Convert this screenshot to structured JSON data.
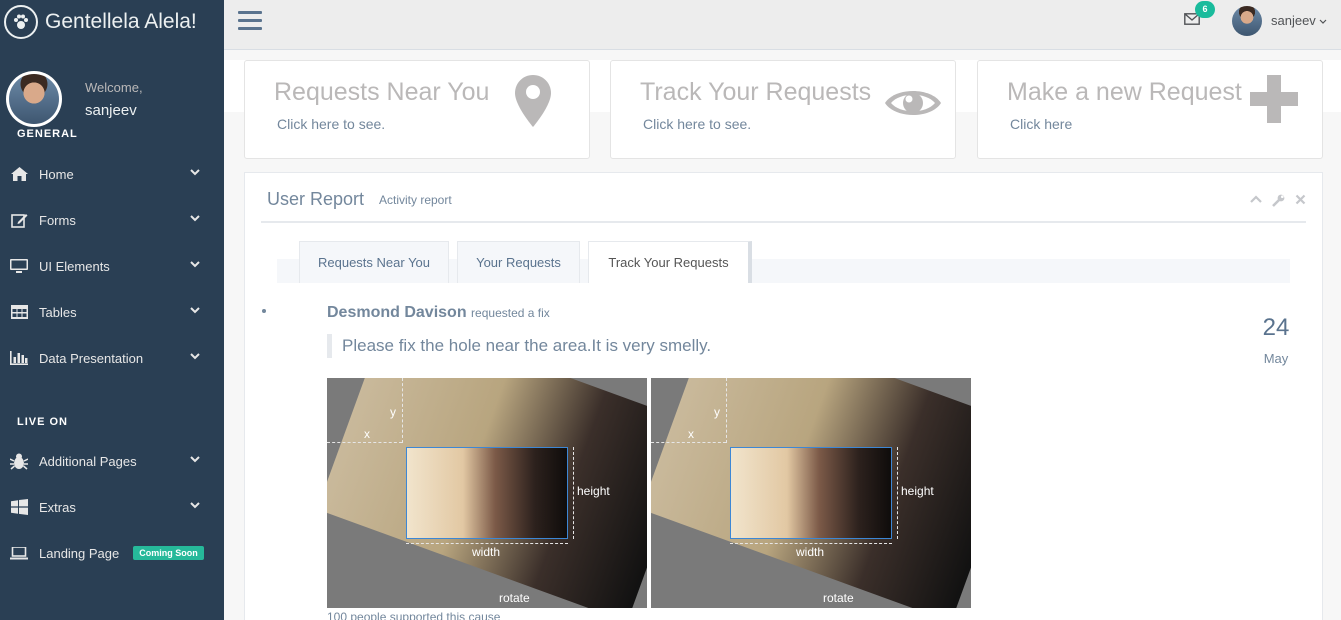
{
  "brand": {
    "name": "Gentellela Alela!"
  },
  "profile": {
    "welcome": "Welcome,",
    "username": "sanjeev"
  },
  "sidebar": {
    "sections": [
      {
        "title": "GENERAL",
        "items": [
          {
            "label": "Home",
            "icon": "home-icon"
          },
          {
            "label": "Forms",
            "icon": "edit-icon"
          },
          {
            "label": "UI Elements",
            "icon": "desktop-icon"
          },
          {
            "label": "Tables",
            "icon": "table-icon"
          },
          {
            "label": "Data Presentation",
            "icon": "bar-chart-icon"
          }
        ]
      },
      {
        "title": "LIVE ON",
        "items": [
          {
            "label": "Additional Pages",
            "icon": "bug-icon"
          },
          {
            "label": "Extras",
            "icon": "windows-icon"
          },
          {
            "label": "Landing Page",
            "icon": "laptop-icon",
            "badge": "Coming Soon"
          }
        ]
      }
    ]
  },
  "topnav": {
    "mail_count": "6",
    "user": "sanjeev"
  },
  "tiles": [
    {
      "title": "Requests Near You",
      "subtitle": "Click here to see.",
      "icon": "map-marker-icon"
    },
    {
      "title": "Track Your Requests",
      "subtitle": "Click here to see.",
      "icon": "eye-icon"
    },
    {
      "title": "Make a new Request",
      "subtitle": "Click here",
      "icon": "plus-icon"
    }
  ],
  "panel": {
    "title": "User Report",
    "subtitle": "Activity report",
    "tabs": [
      "Requests Near You",
      "Your Requests",
      "Track Your Requests"
    ],
    "active_tab": "Track Your Requests",
    "activity": {
      "actor": "Desmond Davison",
      "action": "requested a fix",
      "message": "Please fix the hole near the area.It is very smelly.",
      "day": "24",
      "month": "May",
      "image_labels": {
        "x": "x",
        "y": "y",
        "width": "width",
        "height": "height",
        "rotate": "rotate"
      },
      "supported": "100 people supported this cause"
    }
  },
  "colors": {
    "sidebar": "#2A3F54",
    "accent": "#1ABB9C",
    "badge_green": "#26B99A",
    "text": "#73879C"
  }
}
